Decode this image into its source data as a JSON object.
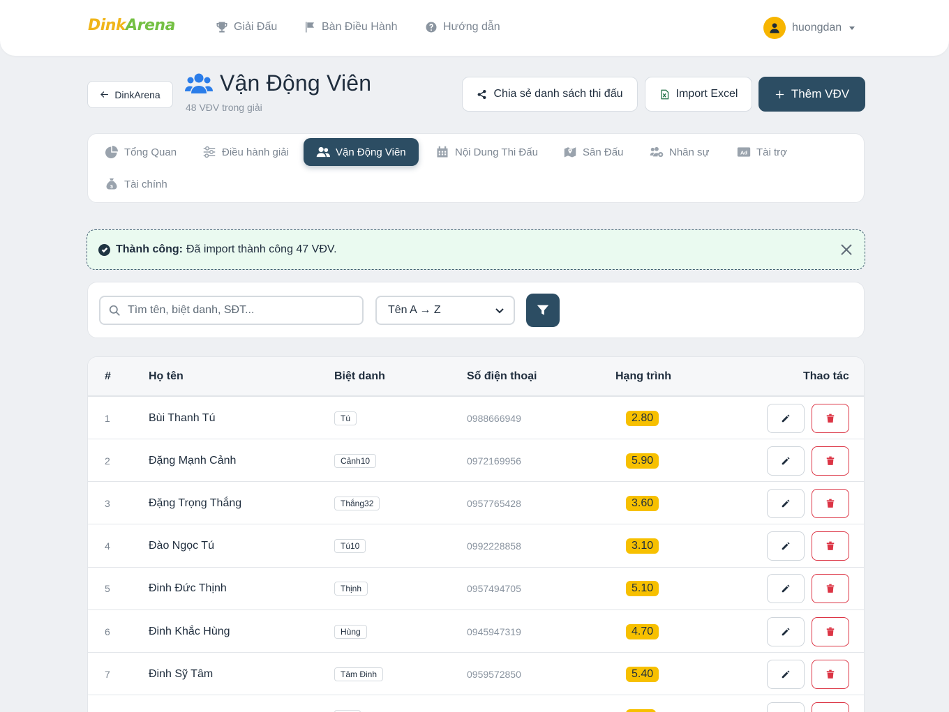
{
  "brand": {
    "part1": "Dink",
    "part2": "Arena"
  },
  "nav": {
    "items": [
      {
        "label": "Giải Đấu",
        "icon": "trophy-icon"
      },
      {
        "label": "Bàn Điều Hành",
        "icon": "flag-icon"
      },
      {
        "label": "Hướng dẫn",
        "icon": "question-circle-icon"
      }
    ],
    "user": {
      "name": "huongdan"
    }
  },
  "header": {
    "back_label": "DinkArena",
    "title": "Vận Động Viên",
    "subtitle": "48 VĐV trong giải",
    "share_label": "Chia sẻ danh sách thi đấu",
    "import_label": "Import Excel",
    "add_label": "Thêm VĐV"
  },
  "tabs": [
    {
      "label": "Tổng Quan",
      "icon": "pie-chart-icon"
    },
    {
      "label": "Điều hành giải",
      "icon": "sliders-icon"
    },
    {
      "label": "Vận Động Viên",
      "icon": "users-icon",
      "active": true
    },
    {
      "label": "Nội Dung Thi Đấu",
      "icon": "calendar-icon"
    },
    {
      "label": "Sân Đấu",
      "icon": "map-icon"
    },
    {
      "label": "Nhân sự",
      "icon": "users-cog-icon"
    },
    {
      "label": "Tài trợ",
      "icon": "ad-icon"
    },
    {
      "label": "Tài chính",
      "icon": "money-bag-icon"
    }
  ],
  "alert": {
    "title": "Thành công:",
    "message": "Đã import thành công 47 VĐV."
  },
  "filters": {
    "search_placeholder": "Tìm tên, biệt danh, SĐT...",
    "sort_value": "Tên A → Z"
  },
  "table": {
    "headers": {
      "index": "#",
      "name": "Họ tên",
      "nickname": "Biệt danh",
      "phone": "Số điện thoại",
      "rank": "Hạng trình",
      "actions": "Thao tác"
    },
    "rows": [
      {
        "index": "1",
        "name": "Bùi Thanh Tú",
        "nickname": "Tú",
        "phone": "0988666949",
        "rank": "2.80"
      },
      {
        "index": "2",
        "name": "Đặng Mạnh Cảnh",
        "nickname": "Cảnh10",
        "phone": "0972169956",
        "rank": "5.90"
      },
      {
        "index": "3",
        "name": "Đặng Trọng Thắng",
        "nickname": "Thắng32",
        "phone": "0957765428",
        "rank": "3.60"
      },
      {
        "index": "4",
        "name": "Đào Ngọc Tú",
        "nickname": "Tú10",
        "phone": "0992228858",
        "rank": "3.10"
      },
      {
        "index": "5",
        "name": "Đinh Đức Thịnh",
        "nickname": "Thịnh",
        "phone": "0957494705",
        "rank": "5.10"
      },
      {
        "index": "6",
        "name": "Đinh Khắc Hùng",
        "nickname": "Hùng",
        "phone": "0945947319",
        "rank": "4.70"
      },
      {
        "index": "7",
        "name": "Đinh Sỹ Tâm",
        "nickname": "Tâm Đinh",
        "phone": "0959572850",
        "rank": "5.40"
      }
    ]
  },
  "colors": {
    "primary": "#2c4d63",
    "rank_badge": "#f7c000",
    "danger": "#dc3545",
    "success_bg": "#eafaf0",
    "brand_yellow": "#f0b51a",
    "brand_green": "#74c043"
  }
}
